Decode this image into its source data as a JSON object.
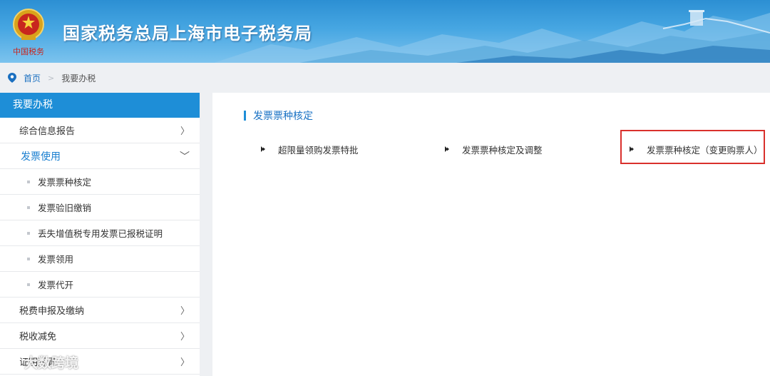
{
  "header": {
    "title": "国家税务总局上海市电子税务局",
    "emblem_icon": "national-tax-emblem-icon",
    "emblem_text": "中国税务"
  },
  "breadcrumb": {
    "home": "首页",
    "separator": ">",
    "current": "我要办税"
  },
  "sidebar": {
    "heading": "我要办税",
    "items": [
      {
        "label": "综合信息报告",
        "chevron": "〉"
      },
      {
        "label": "发票使用",
        "chevron": "﹀"
      },
      {
        "label": "税费申报及缴纳",
        "chevron": "〉"
      },
      {
        "label": "税收减免",
        "chevron": "〉"
      },
      {
        "label": "证明开具",
        "chevron": "〉"
      }
    ],
    "subitems": [
      {
        "label": "发票票种核定"
      },
      {
        "label": "发票验旧缴销"
      },
      {
        "label": "丢失增值税专用发票已报税证明"
      },
      {
        "label": "发票领用"
      },
      {
        "label": "发票代开"
      }
    ]
  },
  "main": {
    "section_title": "发票票种核定",
    "options": [
      {
        "label": "超限量领购发票特批"
      },
      {
        "label": "发票票种核定及调整"
      },
      {
        "label": "发票票种核定（变更购票人）"
      }
    ]
  },
  "watermark": {
    "text": "大数跨境"
  },
  "colors": {
    "accent": "#1e8ed7",
    "link": "#1a72c4",
    "highlight": "#d9302c"
  }
}
